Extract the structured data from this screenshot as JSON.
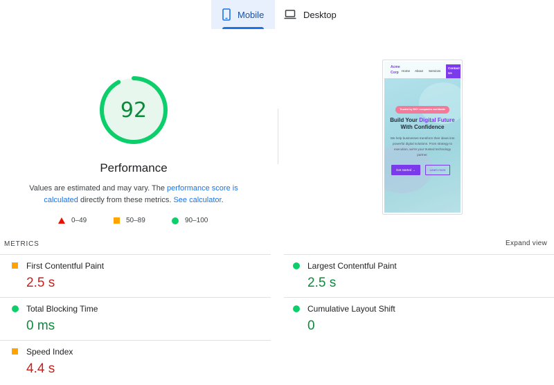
{
  "tabs": [
    {
      "label": "Mobile",
      "icon": "smartphone-icon",
      "active": true
    },
    {
      "label": "Desktop",
      "icon": "laptop-icon",
      "active": false
    }
  ],
  "performance": {
    "score": "92",
    "score_value": 92,
    "title": "Performance",
    "desc_prefix": "Values are estimated and may vary. The ",
    "desc_link1": "performance score is calculated",
    "desc_middle": " directly from these metrics. ",
    "desc_link2": "See calculator",
    "desc_suffix": "."
  },
  "legend": [
    {
      "shape": "triangle",
      "label": "0–49",
      "color": "#eb0f00"
    },
    {
      "shape": "square",
      "label": "50–89",
      "color": "#ffa400"
    },
    {
      "shape": "circle",
      "label": "90–100",
      "color": "#0cce6b"
    }
  ],
  "preview": {
    "logo": "Acme Corp",
    "nav": [
      "Home",
      "About",
      "Services"
    ],
    "contact": "Contact Us",
    "badge": "Trusted by 500+ companies worldwide",
    "heading_pre": "Build Your ",
    "heading_highlight": "Digital Future",
    "heading_post": " With Confidence",
    "subtext": "We help businesses transform their ideas into powerful digital solutions. From strategy to execution, we're your trusted technology partner.",
    "primary_button": "Get started →",
    "secondary_button": "Learn more"
  },
  "metrics": {
    "header": "METRICS",
    "expand": "Expand view",
    "items": [
      {
        "name": "First Contentful Paint",
        "value": "2.5 s",
        "status": "average"
      },
      {
        "name": "Largest Contentful Paint",
        "value": "2.5 s",
        "status": "good"
      },
      {
        "name": "Total Blocking Time",
        "value": "0 ms",
        "status": "good"
      },
      {
        "name": "Cumulative Layout Shift",
        "value": "0",
        "status": "good"
      },
      {
        "name": "Speed Index",
        "value": "4.4 s",
        "status": "average"
      }
    ]
  },
  "colors": {
    "good": "#0cce6b",
    "average": "#ffa400",
    "poor": "#eb0f00",
    "accent": "#1a73e8"
  }
}
